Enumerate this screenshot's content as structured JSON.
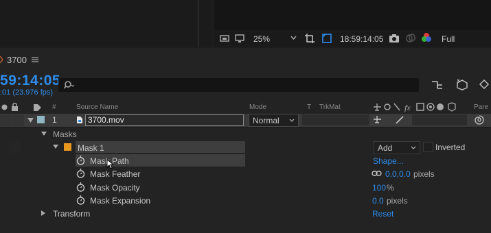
{
  "viewer": {
    "zoom": "25%",
    "timecode": "18:59:14:05",
    "resolution": "Full"
  },
  "tab": {
    "name": "3700"
  },
  "timeline": {
    "current_time": "59:14:05",
    "fps": ":01 (23.976 fps)"
  },
  "columns": {
    "number": "#",
    "source_name": "Source Name",
    "mode": "Mode",
    "t": "T",
    "trkmat": "TrkMat",
    "parent": "Pare"
  },
  "layer": {
    "number": "1",
    "name": "3700.mov",
    "mode": "Normal"
  },
  "masks": {
    "group_label": "Masks",
    "mask_name": "Mask 1",
    "mode": "Add",
    "inverted_label": "Inverted"
  },
  "properties": [
    {
      "name": "Mask Path",
      "value": "Shape...",
      "unit": ""
    },
    {
      "name": "Mask Feather",
      "value": "0.0,0.0",
      "unit": "pixels"
    },
    {
      "name": "Mask Opacity",
      "value": "100",
      "unit": "%"
    },
    {
      "name": "Mask Expansion",
      "value": "0.0",
      "unit": "pixels"
    }
  ],
  "transform": {
    "label": "Transform",
    "reset": "Reset"
  },
  "colors": {
    "accent": "#2d8ceb",
    "label_orange": "#e8961e",
    "label_teal": "#8fb8c4"
  }
}
